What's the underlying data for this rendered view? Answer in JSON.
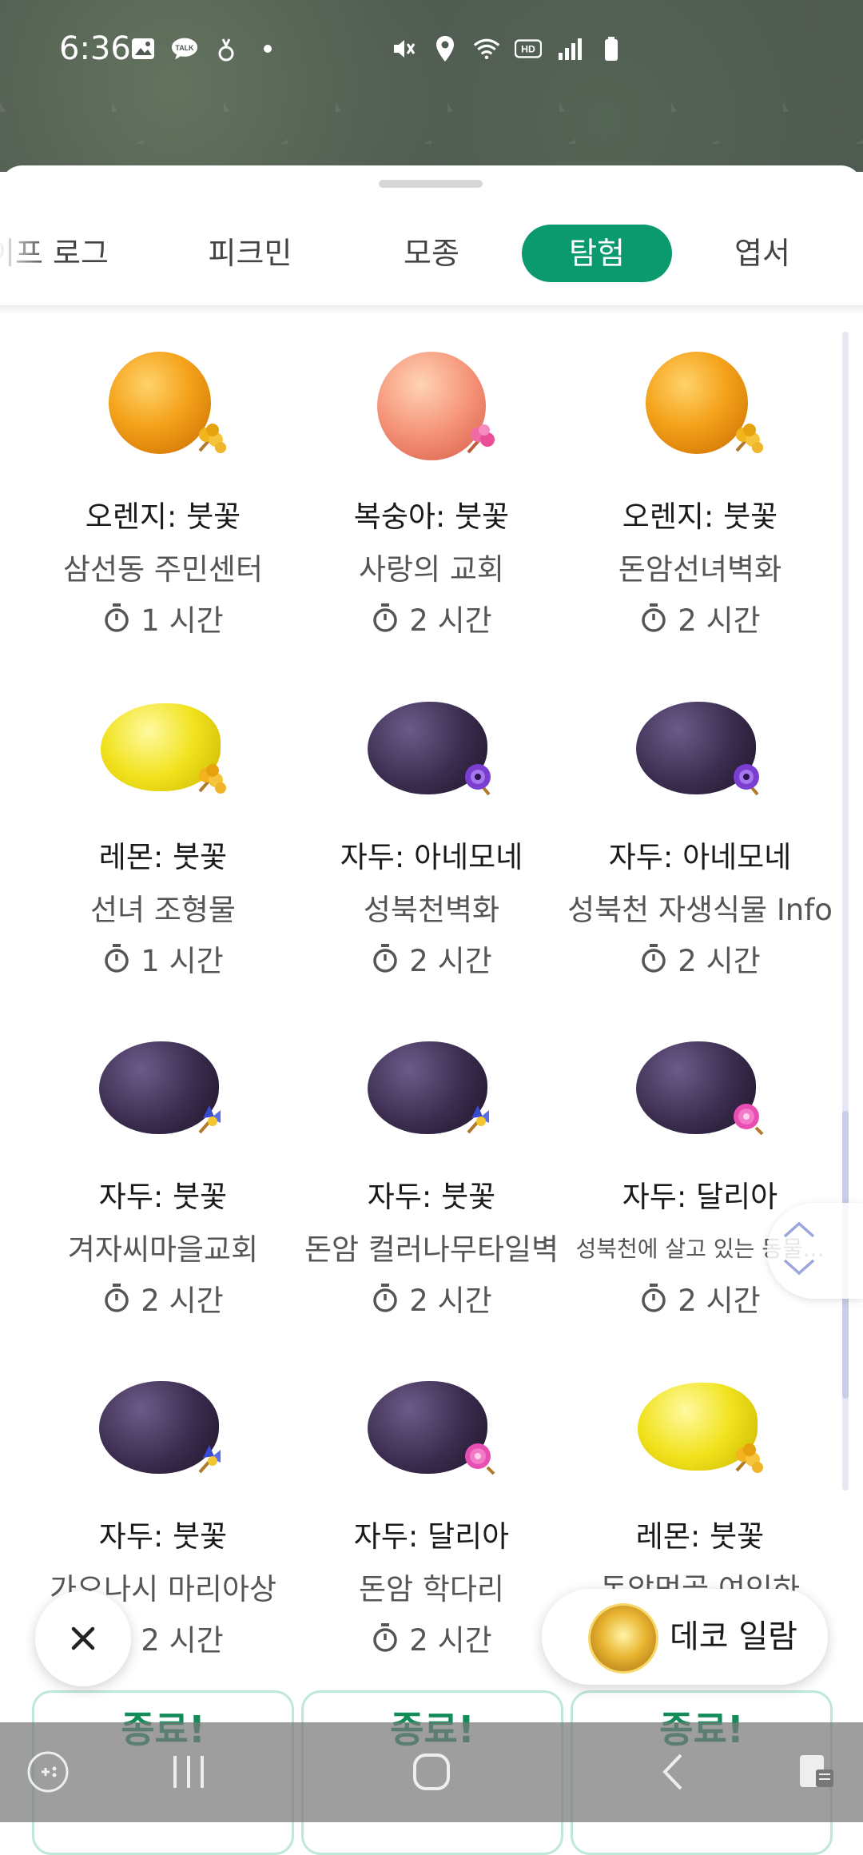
{
  "status_bar": {
    "time": "6:36",
    "left_icons": [
      "gallery-icon",
      "talk-icon",
      "hand-icon",
      "dot-icon"
    ],
    "right_icons": [
      "mute-icon",
      "location-icon",
      "wifi-icon",
      "hd-icon",
      "signal-icon",
      "battery-icon"
    ],
    "talk_text": "TALK",
    "hd_text": "HD"
  },
  "tabs": [
    {
      "label": "라이프 로그",
      "visible_text": "이프 로그"
    },
    {
      "label": "피크민"
    },
    {
      "label": "모종"
    },
    {
      "label": "탐험",
      "active": true
    },
    {
      "label": "엽서"
    }
  ],
  "expeditions": [
    {
      "fruit": "orange",
      "flower": "bluebell-yellow",
      "title": "오렌지: 붓꽃",
      "place": "삼선동 주민센터",
      "time": "1 시간"
    },
    {
      "fruit": "peach",
      "flower": "pink",
      "title": "복숭아: 붓꽃",
      "place": "사랑의 교회",
      "time": "2 시간"
    },
    {
      "fruit": "orange",
      "flower": "bluebell-yellow",
      "title": "오렌지: 붓꽃",
      "place": "돈암선녀벽화",
      "time": "2 시간"
    },
    {
      "fruit": "lemon",
      "flower": "bluebell-yellow",
      "title": "레몬: 붓꽃",
      "place": "선녀 조형물",
      "time": "1 시간"
    },
    {
      "fruit": "plum",
      "flower": "anemone",
      "title": "자두: 아네모네",
      "place": "성북천벽화",
      "time": "2 시간"
    },
    {
      "fruit": "plum",
      "flower": "anemone",
      "title": "자두: 아네모네",
      "place": "성북천 자생식물 Info",
      "time": "2 시간"
    },
    {
      "fruit": "plum",
      "flower": "iris-blue",
      "title": "자두: 붓꽃",
      "place": "겨자씨마을교회",
      "time": "2 시간"
    },
    {
      "fruit": "plum",
      "flower": "iris-blue",
      "title": "자두: 붓꽃",
      "place": "돈암 컬러나무타일벽",
      "time": "2 시간"
    },
    {
      "fruit": "plum",
      "flower": "dahlia",
      "title": "자두: 달리아",
      "place": "성북천에 살고 있는 동물...",
      "time": "2 시간",
      "small": true
    },
    {
      "fruit": "plum",
      "flower": "iris-blue",
      "title": "자두: 붓꽃",
      "place": "가오나시 마리아상",
      "time": "2 시간"
    },
    {
      "fruit": "plum",
      "flower": "dahlia",
      "title": "자두: 달리아",
      "place": "돈암 학다리",
      "time": "2 시간"
    },
    {
      "fruit": "lemon",
      "flower": "bluebell-yellow",
      "title": "레몬: 붓꽃",
      "place": "돈암먹골 여인하",
      "time": ""
    }
  ],
  "bottom_cards": [
    {
      "label": "종료!"
    },
    {
      "label": "종료!"
    },
    {
      "label": "종료!"
    }
  ],
  "fab": {
    "close_icon": "close-icon",
    "deco_label": "데코 일람"
  },
  "colors": {
    "accent": "#0a9a6e",
    "done": "#138c5a"
  }
}
